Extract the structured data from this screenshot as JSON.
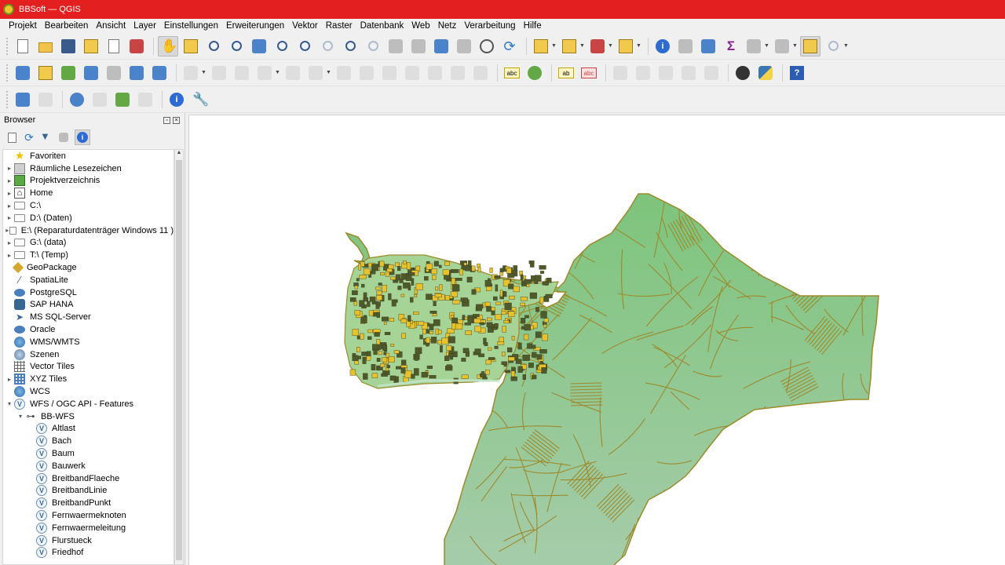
{
  "window": {
    "title": "BBSoft — QGIS"
  },
  "menu": [
    "Projekt",
    "Bearbeiten",
    "Ansicht",
    "Layer",
    "Einstellungen",
    "Erweiterungen",
    "Vektor",
    "Raster",
    "Datenbank",
    "Web",
    "Netz",
    "Verarbeitung",
    "Hilfe"
  ],
  "toolbar_icons": {
    "row1": [
      "new-project-icon",
      "open-project-icon",
      "save-project-icon",
      "save-as-icon",
      "print-layout-icon",
      "style-manager-icon",
      "pan-hand-icon",
      "pan-to-selection-icon",
      "zoom-in-icon",
      "zoom-out-icon",
      "zoom-full-icon",
      "zoom-to-selection-icon",
      "zoom-to-layer-icon",
      "zoom-native-icon",
      "zoom-last-icon",
      "zoom-next-icon",
      "new-map-view-icon",
      "new-3d-view-icon",
      "new-bookmark-icon",
      "show-bookmarks-icon",
      "temporal-controller-icon",
      "refresh-icon",
      "select-features-icon",
      "select-by-value-icon",
      "deselect-icon",
      "select-by-expression-icon",
      "identify-icon",
      "attribute-table-icon",
      "field-calculator-icon",
      "statistics-sigma-icon",
      "toolbox-icon",
      "measure-icon",
      "map-tips-icon",
      "locator-icon"
    ],
    "row2": [
      "data-source-manager-icon",
      "new-geopackage-icon",
      "new-shapefile-icon",
      "new-spatialite-icon",
      "new-temp-layer-icon",
      "new-virtual-layer-icon",
      "new-vector-icon",
      "edit-pencil-icon",
      "save-edits-icon",
      "toggle-editing-icon",
      "digitize-icon",
      "vertex-tool-icon",
      "delete-selected-icon",
      "cut-icon",
      "copy-icon",
      "paste-icon",
      "undo-icon",
      "redo-icon",
      "label-abc-icon",
      "diagram-icon",
      "highlight-pin-icon",
      "label-red-icon",
      "pin-labels-icon",
      "show-hide-labels-icon",
      "move-label-icon",
      "rotate-label-icon",
      "change-label-icon",
      "plugin-network-icon",
      "python-icon",
      "help-icon"
    ],
    "row3": [
      "gps-move-icon",
      "crosshair-icon",
      "globe-tool-icon",
      "add-feature-icon",
      "georef-icon",
      "advanced-digitize-icon",
      "info-icon",
      "settings-wrench-icon"
    ]
  },
  "browser": {
    "title": "Browser",
    "items": [
      {
        "label": "Favoriten",
        "icon": "star-icon",
        "level": 0,
        "arrow": ""
      },
      {
        "label": "Räumliche Lesezeichen",
        "icon": "bookmark-icon",
        "level": 0,
        "arrow": "▸"
      },
      {
        "label": "Projektverzeichnis",
        "icon": "project-folder-icon",
        "level": 0,
        "arrow": "▸"
      },
      {
        "label": "Home",
        "icon": "home-icon",
        "level": 0,
        "arrow": "▸"
      },
      {
        "label": "C:\\",
        "icon": "folder-icon",
        "level": 0,
        "arrow": "▸"
      },
      {
        "label": "D:\\ (Daten)",
        "icon": "folder-icon",
        "level": 0,
        "arrow": "▸"
      },
      {
        "label": "E:\\ (Reparaturdatenträger Windows 11 )",
        "icon": "folder-icon",
        "level": 0,
        "arrow": "▸"
      },
      {
        "label": "G:\\ (data)",
        "icon": "folder-icon",
        "level": 0,
        "arrow": "▸"
      },
      {
        "label": "T:\\ (Temp)",
        "icon": "folder-icon",
        "level": 0,
        "arrow": "▸"
      },
      {
        "label": "GeoPackage",
        "icon": "geopackage-icon",
        "level": 0,
        "arrow": ""
      },
      {
        "label": "SpatiaLite",
        "icon": "spatialite-icon",
        "level": 0,
        "arrow": ""
      },
      {
        "label": "PostgreSQL",
        "icon": "postgresql-icon",
        "level": 0,
        "arrow": ""
      },
      {
        "label": "SAP HANA",
        "icon": "sap-hana-icon",
        "level": 0,
        "arrow": ""
      },
      {
        "label": "MS SQL-Server",
        "icon": "mssql-icon",
        "level": 0,
        "arrow": ""
      },
      {
        "label": "Oracle",
        "icon": "oracle-icon",
        "level": 0,
        "arrow": ""
      },
      {
        "label": "WMS/WMTS",
        "icon": "wms-globe-icon",
        "level": 0,
        "arrow": ""
      },
      {
        "label": "Szenen",
        "icon": "scenes-icon",
        "level": 0,
        "arrow": ""
      },
      {
        "label": "Vector Tiles",
        "icon": "vector-tiles-icon",
        "level": 0,
        "arrow": ""
      },
      {
        "label": "XYZ Tiles",
        "icon": "xyz-tiles-icon",
        "level": 0,
        "arrow": "▸"
      },
      {
        "label": "WCS",
        "icon": "wcs-globe-icon",
        "level": 0,
        "arrow": ""
      },
      {
        "label": "WFS / OGC API - Features",
        "icon": "wfs-icon",
        "level": 0,
        "arrow": "▾"
      },
      {
        "label": "BB-WFS",
        "icon": "wfs-connection-icon",
        "level": 1,
        "arrow": "▾"
      },
      {
        "label": "Altlast",
        "icon": "wfs-layer-icon",
        "level": 2,
        "arrow": ""
      },
      {
        "label": "Bach",
        "icon": "wfs-layer-icon",
        "level": 2,
        "arrow": ""
      },
      {
        "label": "Baum",
        "icon": "wfs-layer-icon",
        "level": 2,
        "arrow": ""
      },
      {
        "label": "Bauwerk",
        "icon": "wfs-layer-icon",
        "level": 2,
        "arrow": ""
      },
      {
        "label": "BreitbandFlaeche",
        "icon": "wfs-layer-icon",
        "level": 2,
        "arrow": ""
      },
      {
        "label": "BreitbandLinie",
        "icon": "wfs-layer-icon",
        "level": 2,
        "arrow": ""
      },
      {
        "label": "BreitbandPunkt",
        "icon": "wfs-layer-icon",
        "level": 2,
        "arrow": ""
      },
      {
        "label": "Fernwaermeknoten",
        "icon": "wfs-layer-icon",
        "level": 2,
        "arrow": ""
      },
      {
        "label": "Fernwaermeleitung",
        "icon": "wfs-layer-icon",
        "level": 2,
        "arrow": ""
      },
      {
        "label": "Flurstueck",
        "icon": "wfs-layer-icon",
        "level": 2,
        "arrow": ""
      },
      {
        "label": "Friedhof",
        "icon": "wfs-layer-icon",
        "level": 2,
        "arrow": ""
      }
    ]
  },
  "colors": {
    "titlebar": "#e41f1f",
    "parcel_fill": "#7cc47a",
    "parcel_stroke": "#9c8a2c",
    "building_fill": "#e7c22c"
  }
}
